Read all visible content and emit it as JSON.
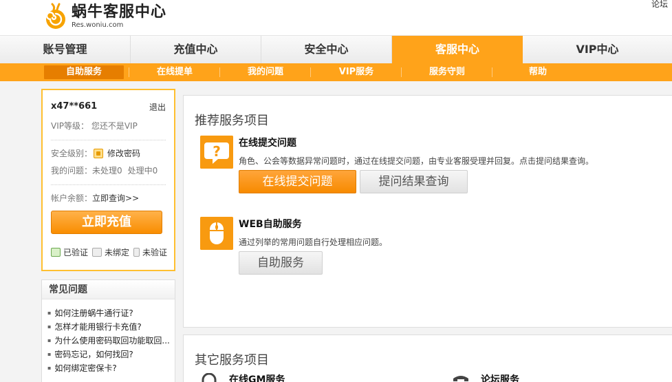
{
  "header": {
    "logo_title": "蜗牛客服中心",
    "logo_sub": "Res.woniu.com",
    "forum_link": "论坛"
  },
  "main_nav": [
    {
      "label": "账号管理",
      "active": false
    },
    {
      "label": "充值中心",
      "active": false
    },
    {
      "label": "安全中心",
      "active": false
    },
    {
      "label": "客服中心",
      "active": true
    },
    {
      "label": "VIP中心",
      "active": false
    }
  ],
  "sub_nav": [
    {
      "label": "自助服务",
      "active": true
    },
    {
      "label": "在线提单",
      "active": false
    },
    {
      "label": "我的问题",
      "active": false
    },
    {
      "label": "VIP服务",
      "active": false
    },
    {
      "label": "服务守则",
      "active": false
    },
    {
      "label": "帮助",
      "active": false
    }
  ],
  "user": {
    "name": "x47**661",
    "logout": "退出",
    "vip_label": "VIP等级：",
    "vip_value": "您还不是VIP",
    "security_label": "安全级别：",
    "change_password": "修改密码",
    "my_issues_label": "我的问题：",
    "unhandled": "未处理0",
    "processing": "处理中0",
    "balance_label": "帐户余额：",
    "query_now": "立即查询>>",
    "recharge_button": "立即充值",
    "verify": [
      {
        "label": "已验证",
        "icon": "shield-check-icon"
      },
      {
        "label": "未绑定",
        "icon": "mail-icon"
      },
      {
        "label": "未验证",
        "icon": "phone-icon"
      }
    ]
  },
  "faq": {
    "title": "常见问题",
    "items": [
      "如何注册蜗牛通行证?",
      "怎样才能用银行卡充值?",
      "为什么使用密码取回功能取回...",
      "密码忘记，如何找回?",
      "如何绑定密保卡?"
    ]
  },
  "recommended": {
    "title": "推荐服务项目",
    "services": [
      {
        "name": "在线提交问题",
        "icon": "question-bubble-icon",
        "desc": "角色、公会等数据异常问题时，通过在线提交问题，由专业客服受理并回复。点击提问结果查询。",
        "primary_button": "在线提交问题",
        "secondary_button": "提问结果查询"
      },
      {
        "name": "WEB自助服务",
        "icon": "mouse-icon",
        "desc": "通过列举的常用问题自行处理相应问题。",
        "button": "自助服务"
      }
    ]
  },
  "other": {
    "title": "其它服务项目",
    "services": [
      {
        "name": "在线GM服务",
        "icon": "headset-icon"
      },
      {
        "name": "论坛服务",
        "icon": "telephone-icon"
      }
    ]
  },
  "colors": {
    "accent": "#ffa31a",
    "accent_dark": "#e67e00"
  }
}
